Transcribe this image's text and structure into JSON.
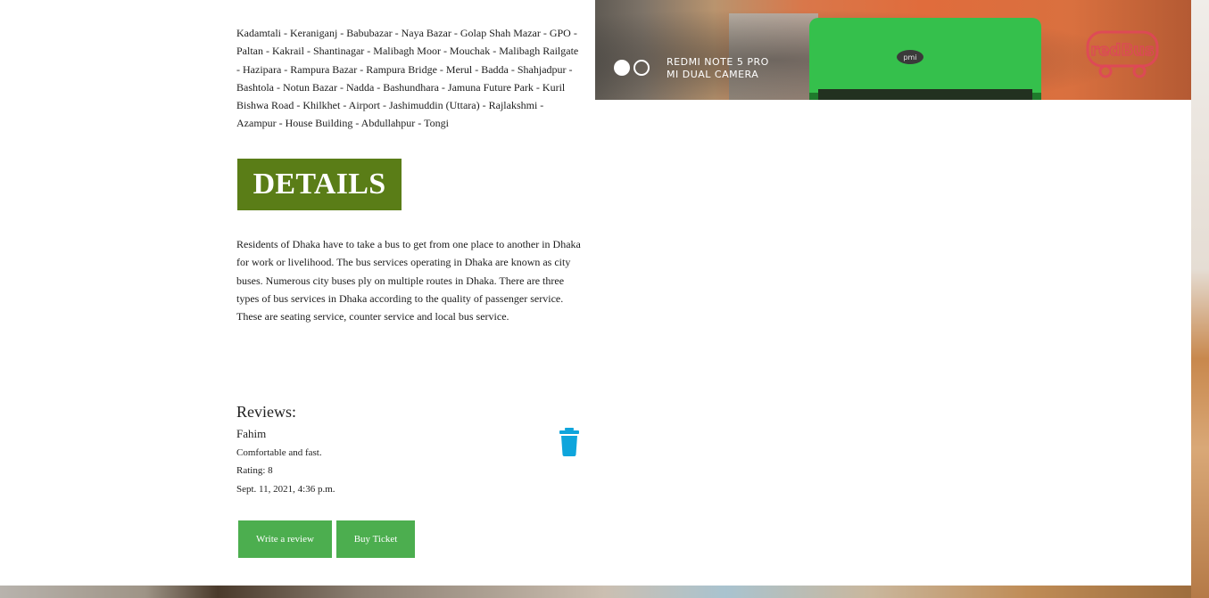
{
  "route": {
    "stops_text": "Kadamtali - Keraniganj - Babubazar - Naya Bazar - Golap Shah Mazar - GPO - Paltan - Kakrail - Shantinagar - Malibagh Moor - Mouchak - Malibagh Railgate - Hazipara - Rampura Bazar - Rampura Bridge - Merul - Badda - Shahjadpur - Bashtola - Notun Bazar - Nadda - Bashundhara - Jamuna Future Park - Kuril Bishwa Road - Khilkhet - Airport - Jashimuddin (Uttara) - Rajlakshmi - Azampur - House Building - Abdullahpur - Tongi"
  },
  "details": {
    "heading": "DETAILS",
    "heading_bg": "#5a7d17",
    "description": "Residents of Dhaka have to take a bus to get from one place to another in Dhaka for work or livelihood. The bus services operating in Dhaka are known as city buses. Numerous city buses ply on multiple routes in Dhaka. There are three types of bus services in Dhaka according to the quality of passenger service. These are seating service, counter service and local bus service."
  },
  "photo": {
    "watermark_line1": "REDMI NOTE 5 PRO",
    "watermark_line2": "MI DUAL CAMERA",
    "badge_text": "pmi",
    "logo_text": "redBus",
    "logo_color": "#e0455b"
  },
  "reviews": {
    "heading": "Reviews:",
    "items": [
      {
        "author": "Fahim",
        "comment": "Comfortable and fast.",
        "rating": "Rating: 8",
        "date": "Sept. 11, 2021, 4:36 p.m.",
        "delete_icon": "trash-icon",
        "delete_color": "#0ea5dc"
      }
    ]
  },
  "actions": {
    "write_review_label": "Write a review",
    "buy_ticket_label": "Buy Ticket",
    "button_color": "#4cae4f"
  }
}
